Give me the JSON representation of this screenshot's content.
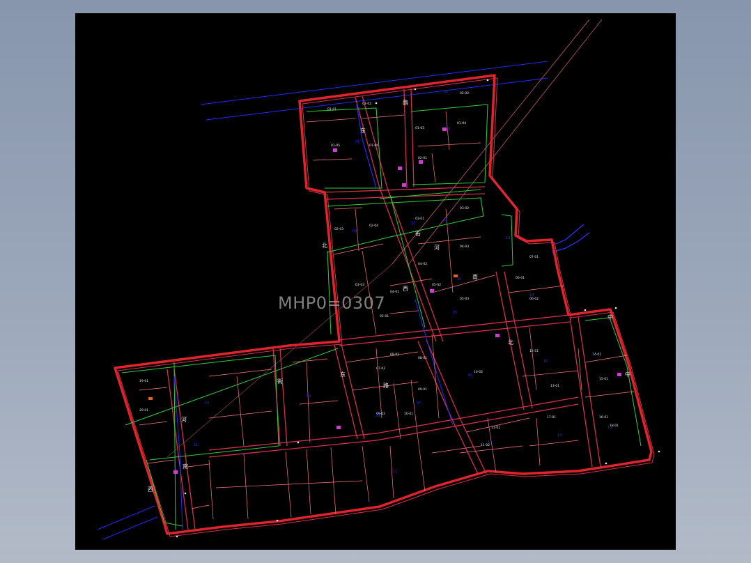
{
  "drawing": {
    "watermark": "MHP0=0307",
    "colors": {
      "background": "#000000",
      "boundary": "#e0242c",
      "road_edge": "#d6304a",
      "parcel": "#ff7b7b",
      "green_line": "#2ecf3a",
      "blue_line": "#1c2cff",
      "river": "#2a36ff",
      "magenta_marker": "#d23cd2",
      "orange_marker": "#e0641e",
      "label": "#e8e8e8"
    },
    "parcel_labels": [
      "01-01",
      "01-02",
      "01-03",
      "01-04",
      "01-05",
      "01-06",
      "02-01",
      "02-02",
      "02-03",
      "02-04",
      "03-01",
      "03-02",
      "03-03",
      "04-01",
      "04-02",
      "04-03",
      "05-01",
      "05-02",
      "05-03",
      "06-01",
      "06-02",
      "07-01",
      "07-02",
      "08-01",
      "08-02",
      "09-01",
      "09-02",
      "10-01",
      "10-02",
      "11-01",
      "11-02",
      "12-01",
      "13-01",
      "14-01",
      "15-01",
      "16-01",
      "17-01",
      "18-01",
      "19-01",
      "20-01"
    ],
    "blue_labels": [
      "01",
      "02",
      "03",
      "04",
      "05",
      "06",
      "07",
      "08",
      "09",
      "10",
      "11",
      "12",
      "13",
      "14",
      "15",
      "16",
      "17",
      "18",
      "19",
      "20",
      "21",
      "22"
    ],
    "road_labels": [
      "东",
      "路",
      "街",
      "河",
      "西",
      "南",
      "北",
      "中"
    ]
  }
}
